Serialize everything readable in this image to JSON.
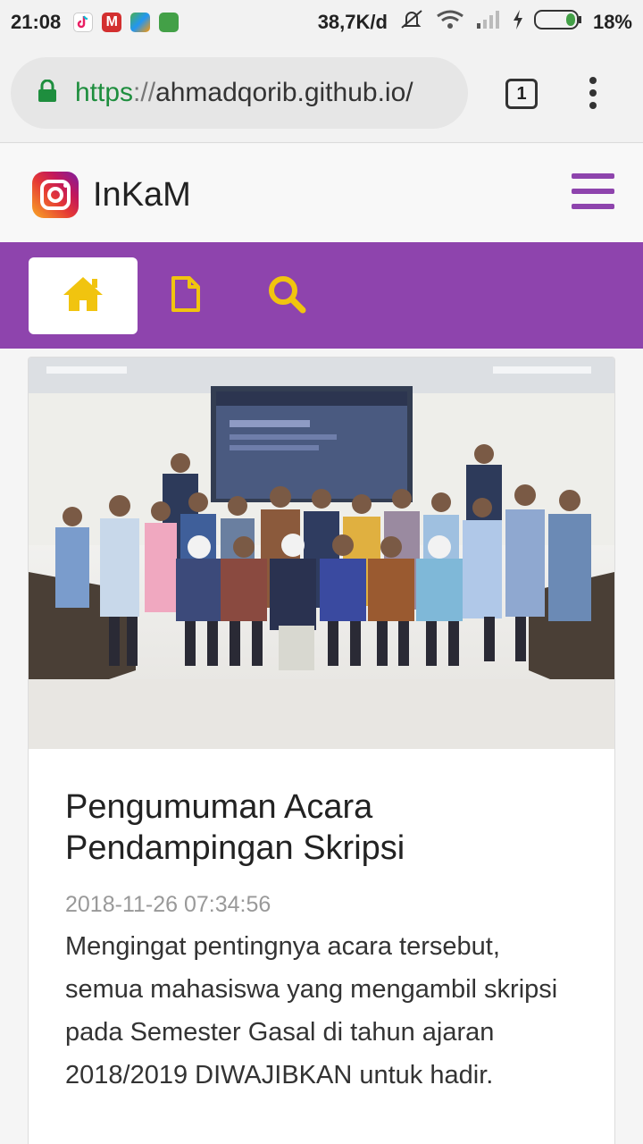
{
  "status_bar": {
    "time": "21:08",
    "network_speed": "38,7K/d",
    "battery": "18%"
  },
  "browser": {
    "url_scheme": "https",
    "url_separator": "://",
    "url_host": "ahmadqorib.github.io/",
    "tab_count": "1"
  },
  "site": {
    "brand": "InKaM",
    "accent_color": "#8e44ad",
    "nav_icon_color": "#f1c40f",
    "nav": [
      {
        "icon": "home-icon",
        "active": true
      },
      {
        "icon": "document-icon",
        "active": false
      },
      {
        "icon": "search-icon",
        "active": false
      }
    ]
  },
  "post": {
    "title": "Pengumuman Acara Pendampingan Skripsi",
    "date": "2018-11-26 07:34:56",
    "excerpt": "Mengingat pentingnya acara tersebut, semua mahasiswa yang mengambil skripsi pada Semester Gasal di tahun ajaran 2018/2019 DIWAJIBKAN untuk hadir."
  }
}
